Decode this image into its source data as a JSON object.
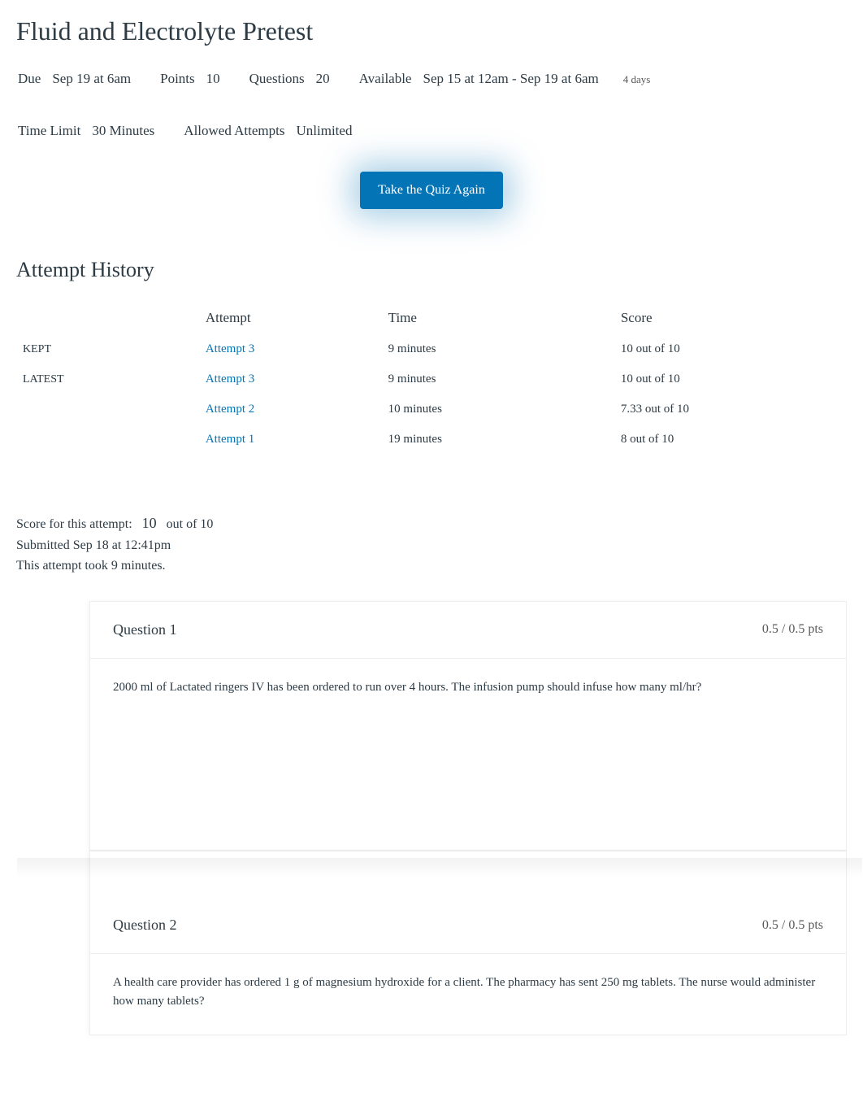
{
  "page": {
    "title": "Fluid and Electrolyte Pretest"
  },
  "meta": {
    "due_label": "Due",
    "due_value": "Sep 19 at 6am",
    "points_label": "Points",
    "points_value": "10",
    "questions_label": "Questions",
    "questions_value": "20",
    "available_label": "Available",
    "available_value": "Sep 15 at 12am - Sep 19 at 6am",
    "available_duration": "4 days",
    "time_limit_label": "Time Limit",
    "time_limit_value": "30 Minutes",
    "allowed_attempts_label": "Allowed Attempts",
    "allowed_attempts_value": "Unlimited"
  },
  "actions": {
    "take_again": "Take the Quiz Again"
  },
  "history": {
    "title": "Attempt History",
    "headers": {
      "status": "",
      "attempt": "Attempt",
      "time": "Time",
      "score": "Score"
    },
    "rows": [
      {
        "status": "KEPT",
        "attempt": "Attempt 3",
        "time": "9 minutes",
        "score": "10 out of 10"
      },
      {
        "status": "LATEST",
        "attempt": "Attempt 3",
        "time": "9 minutes",
        "score": "10 out of 10"
      },
      {
        "status": "",
        "attempt": "Attempt 2",
        "time": "10 minutes",
        "score": "7.33 out of 10"
      },
      {
        "status": "",
        "attempt": "Attempt 1",
        "time": "19 minutes",
        "score": "8 out of 10"
      }
    ]
  },
  "summary": {
    "score_prefix": "Score for this attempt:",
    "score_value": "10",
    "score_suffix": "out of 10",
    "submitted": "Submitted Sep 18 at 12:41pm",
    "duration": "This attempt took 9 minutes."
  },
  "questions": [
    {
      "title": "Question 1",
      "pts": "0.5 / 0.5 pts",
      "body": "2000 ml of Lactated ringers IV has been ordered to run over 4 hours. The infusion pump should infuse how many ml/hr?"
    },
    {
      "title": "Question 2",
      "pts": "0.5 / 0.5 pts",
      "body": "A health care provider has ordered 1 g of magnesium hydroxide for a client. The pharmacy has sent 250 mg tablets. The nurse would administer how many tablets?"
    }
  ]
}
